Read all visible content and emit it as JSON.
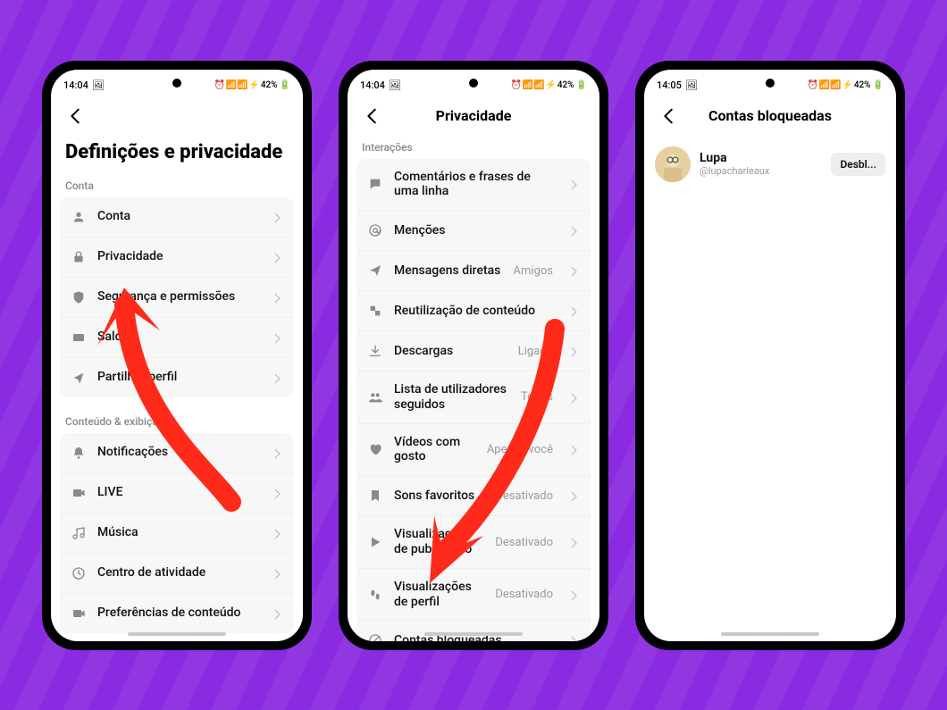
{
  "status": {
    "time1": "14:04",
    "time2": "14:04",
    "time3": "14:05",
    "icons_left": "🖼",
    "icons_right": "⏰ 📶 📶 ⚡",
    "battery": "42%"
  },
  "screen1": {
    "title": "Definições e privacidade",
    "section_account": "Conta",
    "section_content": "Conteúdo & exibição",
    "items_account": [
      {
        "label": "Conta",
        "icon": "user"
      },
      {
        "label": "Privacidade",
        "icon": "lock"
      },
      {
        "label": "Segurança e permissões",
        "icon": "shield"
      },
      {
        "label": "Saldo",
        "icon": "wallet"
      },
      {
        "label": "Partilhar perfil",
        "icon": "share"
      }
    ],
    "items_content": [
      {
        "label": "Notificações",
        "icon": "bell"
      },
      {
        "label": "LIVE",
        "icon": "live"
      },
      {
        "label": "Música",
        "icon": "music"
      },
      {
        "label": "Centro de atividade",
        "icon": "activity"
      },
      {
        "label": "Preferências de conteúdo",
        "icon": "video"
      }
    ]
  },
  "screen2": {
    "header": "Privacidade",
    "section": "Interações",
    "items": [
      {
        "label": "Comentários e frases de uma linha",
        "value": "",
        "icon": "comment"
      },
      {
        "label": "Menções",
        "value": "",
        "icon": "at"
      },
      {
        "label": "Mensagens diretas",
        "value": "Amigos",
        "icon": "send"
      },
      {
        "label": "Reutilização de conteúdo",
        "value": "",
        "icon": "reuse"
      },
      {
        "label": "Descargas",
        "value": "Ligado",
        "icon": "download"
      },
      {
        "label": "Lista de utilizadores seguidos",
        "value": "Todos",
        "icon": "people"
      },
      {
        "label": "Vídeos com gosto",
        "value": "Apenas você",
        "icon": "heart"
      },
      {
        "label": "Sons favoritos",
        "value": "Desativado",
        "icon": "bookmark"
      },
      {
        "label": "Visualizações de publicação",
        "value": "Desativado",
        "icon": "play"
      },
      {
        "label": "Visualizações de perfil",
        "value": "Desativado",
        "icon": "footsteps"
      },
      {
        "label": "Contas bloqueadas",
        "value": "",
        "icon": "block"
      }
    ]
  },
  "screen3": {
    "header": "Contas bloqueadas",
    "user_name": "Lupa",
    "user_handle": "@lupacharleaux",
    "unblock": "Desbl..."
  }
}
